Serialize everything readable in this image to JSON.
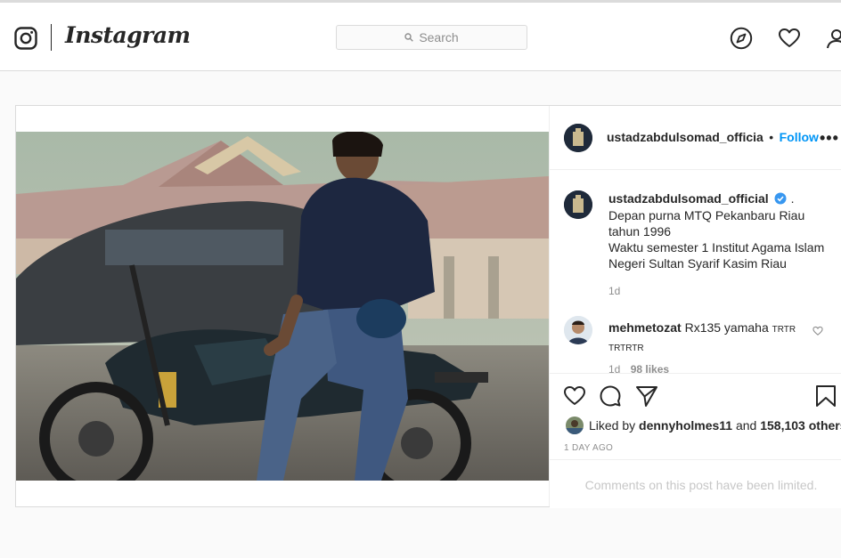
{
  "header": {
    "wordmark": "Instagram",
    "search_placeholder": "Search"
  },
  "post": {
    "username_short": "ustadzabdulsomad_officia",
    "separator": "•",
    "follow_label": "Follow",
    "more_label": "•••",
    "caption": {
      "username": "ustadzabdulsomad_official",
      "trail": ".",
      "lines": [
        "Depan purna MTQ Pekanbaru Riau",
        "tahun 1996",
        "Waktu semester 1 Institut Agama Islam",
        "Negeri Sultan Syarif Kasim Riau"
      ],
      "age": "1d"
    },
    "comment": {
      "username": "mehmetozat",
      "text": "Rx135 yamaha",
      "suffix_1": "TRTR",
      "suffix_2": "TRTRTR",
      "age": "1d",
      "likes": "98 likes"
    },
    "likes": {
      "prefix": "Liked by",
      "user": "dennyholmes11",
      "and": "and",
      "count": "158,103 others"
    },
    "date": "1 DAY AGO",
    "limited": "Comments on this post have been limited."
  },
  "colors": {
    "accent": "#0095f6",
    "verified": "#3897f0"
  }
}
